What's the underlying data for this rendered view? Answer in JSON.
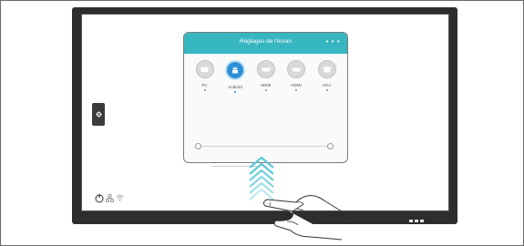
{
  "dialog": {
    "title": "Réglages de l'écran",
    "more_icon": "more-horizontal-icon",
    "sources": [
      {
        "label": "PC",
        "icon": "pc-icon",
        "selected": false
      },
      {
        "label": "Android",
        "icon": "android-icon",
        "selected": true
      },
      {
        "label": "HDMI",
        "icon": "hdmi-icon",
        "selected": false
      },
      {
        "label": "HDMI",
        "icon": "hdmi-icon",
        "selected": false
      },
      {
        "label": "VGA",
        "icon": "vga-icon",
        "selected": false
      }
    ],
    "slider_level": 0.0
  },
  "side_tab": {
    "icon": "gear-icon"
  },
  "status_bar": {
    "icons": [
      "power-icon",
      "network-icon",
      "wifi-icon"
    ]
  },
  "gesture": {
    "direction": "swipe-up",
    "hand_icon": "hand-pointer-icon"
  },
  "colors": {
    "header": "#36b6c0",
    "selected_source": "#2c8fd6",
    "bezel": "#2d2d2d",
    "arrows": "#5bc8d6"
  }
}
